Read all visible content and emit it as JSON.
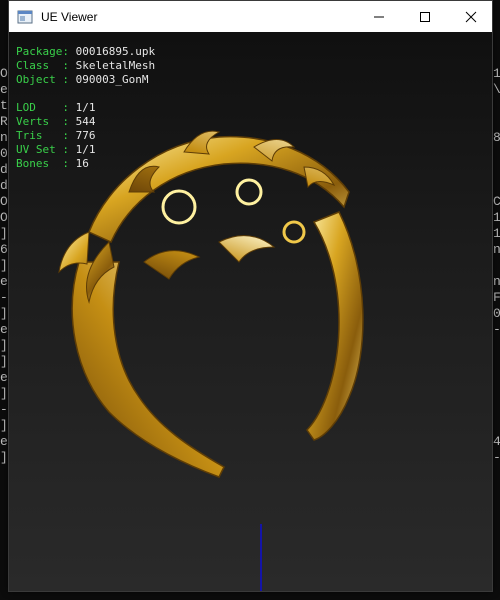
{
  "window": {
    "title": "UE Viewer",
    "controls": {
      "minimize": "minimize-icon",
      "maximize": "maximize-icon",
      "close": "close-icon"
    }
  },
  "info": {
    "package_key": "Package:",
    "package": "00016895.upk",
    "class_key": "Class  :",
    "class": "SkeletalMesh",
    "object_key": "Object :",
    "object": "090003_GonM",
    "lod_key": "LOD    :",
    "lod": "1/1",
    "verts_key": "Verts  :",
    "verts": "544",
    "tris_key": "Tris   :",
    "tris": "776",
    "uvset_key": "UV Set :",
    "uvset": "1/1",
    "bones_key": "Bones  :",
    "bones": "16"
  },
  "background_console": {
    "left_column": "O\ne\nt\nR\nn\n0\nd\nd\nO\nO\n]\n6\n]\ne\n-\n]\ne\n]\n]\ne\n]\n-\n]\ne\n]",
    "right_column": "1\n\\\n\n\n8\n\n\n\nC\n1\n1\nn\n\nn\nF\n0\n-\n\n\n\n\n\n\n4\n-"
  },
  "colors": {
    "label": "#39d04a",
    "value": "#e6e6e6",
    "axis": "#1414a8"
  }
}
